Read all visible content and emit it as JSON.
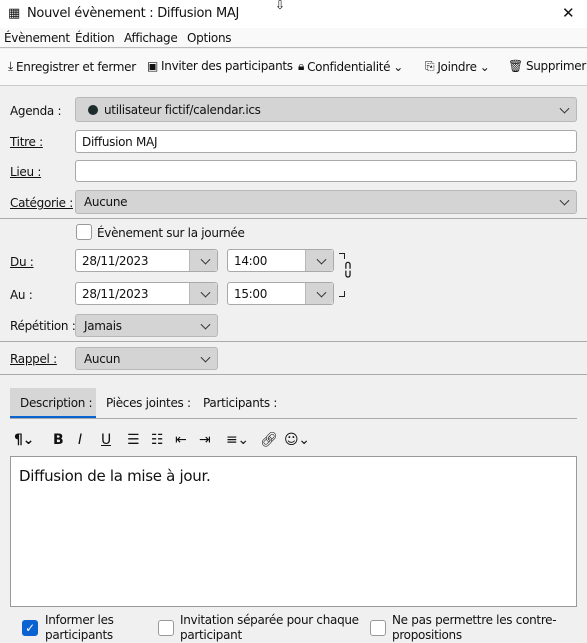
{
  "window": {
    "title": "Nouvel évènement : Diffusion MAJ",
    "close": "✕"
  },
  "menu": [
    "Évènement",
    "Édition",
    "Affichage",
    "Options"
  ],
  "toolbar": {
    "save": "Enregistrer et fermer",
    "invite": "Inviter des participants",
    "privacy": "Confidentialité",
    "attach": "Joindre",
    "delete": "Supprimer"
  },
  "form": {
    "agenda_label": "Agenda :",
    "agenda_value": "utilisateur fictif/calendar.ics",
    "agenda_color": "#1c2b2b",
    "title_label": "Titre :",
    "title_value": "Diffusion MAJ",
    "location_label": "Lieu :",
    "location_value": "",
    "category_label": "Catégorie :",
    "category_value": "Aucune",
    "allday_label": "Évènement sur la journée",
    "allday_checked": false,
    "from_label": "Du :",
    "from_date": "28/11/2023",
    "from_time": "14:00",
    "to_label": "Au :",
    "to_date": "28/11/2023",
    "to_time": "15:00",
    "repeat_label": "Répétition :",
    "repeat_value": "Jamais",
    "reminder_label": "Rappel :",
    "reminder_value": "Aucun"
  },
  "tabs": [
    {
      "label": "Description :",
      "active": true
    },
    {
      "label": "Pièces jointes :"
    },
    {
      "label": "Participants :"
    }
  ],
  "editor": {
    "text": "Diffusion de la mise à jour."
  },
  "options": [
    {
      "label": "Informer les participants",
      "checked": true
    },
    {
      "label": "Invitation séparée pour chaque participant",
      "checked": false
    },
    {
      "label": "Ne pas permettre les contre-propositions",
      "checked": false
    }
  ],
  "accent": "#0a63d1"
}
